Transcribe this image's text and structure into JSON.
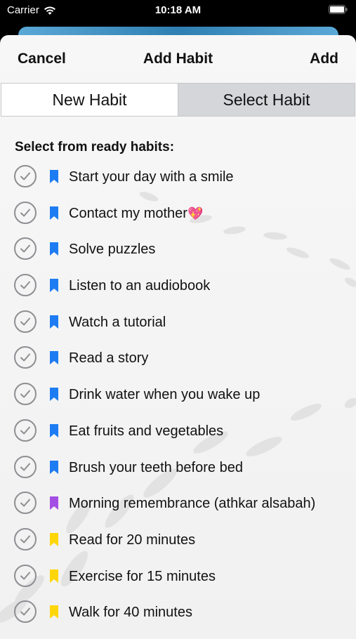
{
  "status_bar": {
    "carrier": "Carrier",
    "time": "10:18 AM"
  },
  "nav": {
    "cancel": "Cancel",
    "title": "Add Habit",
    "add": "Add"
  },
  "segments": [
    {
      "label": "New Habit",
      "selected": false
    },
    {
      "label": "Select Habit",
      "selected": true
    }
  ],
  "section_title": "Select from ready habits:",
  "colors": {
    "blue": "#1e7cf2",
    "purple": "#a44fe3",
    "yellow": "#ffd60a"
  },
  "habits": [
    {
      "label": "Start your day with a smile",
      "emoji": "",
      "color": "blue"
    },
    {
      "label": "Contact my mother",
      "emoji": "💖",
      "color": "blue"
    },
    {
      "label": "Solve puzzles",
      "emoji": "",
      "color": "blue"
    },
    {
      "label": "Listen to an audiobook",
      "emoji": "",
      "color": "blue"
    },
    {
      "label": "Watch a tutorial",
      "emoji": "",
      "color": "blue"
    },
    {
      "label": "Read a story",
      "emoji": "",
      "color": "blue"
    },
    {
      "label": "Drink water when you wake up",
      "emoji": "",
      "color": "blue"
    },
    {
      "label": "Eat fruits and vegetables",
      "emoji": "",
      "color": "blue"
    },
    {
      "label": "Brush your teeth before bed",
      "emoji": "",
      "color": "blue"
    },
    {
      "label": "Morning remembrance (athkar alsabah)",
      "emoji": "",
      "color": "purple"
    },
    {
      "label": "Read for 20 minutes",
      "emoji": "",
      "color": "yellow"
    },
    {
      "label": "Exercise for 15 minutes",
      "emoji": "",
      "color": "yellow"
    },
    {
      "label": "Walk for 40 minutes",
      "emoji": "",
      "color": "yellow"
    }
  ]
}
